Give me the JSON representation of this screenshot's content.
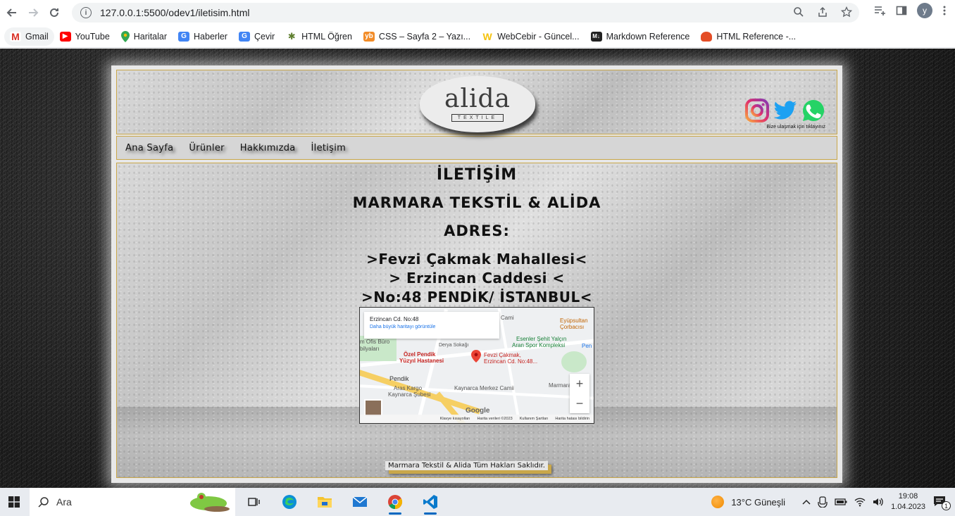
{
  "browser": {
    "url": "127.0.0.1:5500/odev1/iletisim.html",
    "avatar_letter": "y"
  },
  "bookmarks": [
    {
      "label": "Gmail",
      "icon": "gmail-icon",
      "color": "#d93025"
    },
    {
      "label": "YouTube",
      "icon": "youtube-icon",
      "color": "#ff0000"
    },
    {
      "label": "Haritalar",
      "icon": "maps-icon",
      "color": "#34a853"
    },
    {
      "label": "Haberler",
      "icon": "news-icon",
      "color": "#4285f4"
    },
    {
      "label": "Çevir",
      "icon": "translate-icon",
      "color": "#4285f4"
    },
    {
      "label": "HTML Öğren",
      "icon": "bug-icon",
      "color": "#5f7f2f"
    },
    {
      "label": "CSS – Sayfa 2 – Yazı...",
      "icon": "yb-icon",
      "color": "#f28c28"
    },
    {
      "label": "WebCebir - Güncel...",
      "icon": "w-icon",
      "color": "#f4c20d"
    },
    {
      "label": "Markdown Reference",
      "icon": "md-icon",
      "color": "#222222"
    },
    {
      "label": "HTML Reference -...",
      "icon": "html-ref-icon",
      "color": "#e44d26"
    }
  ],
  "site": {
    "logo_name": "alida",
    "logo_sub": "TEXTILE",
    "social_note": "Bize ulaşmak için tıklayınız",
    "nav": [
      "Ana Sayfa",
      "Ürünler",
      "Hakkımızda",
      "İletişim"
    ],
    "heading": "İLETİŞİM",
    "company": "MARMARA TEKSTİL & ALİDA",
    "address_label": "ADRES:",
    "address_lines": [
      ">Fevzi Çakmak Mahallesi<",
      "> Erzincan Caddesi <",
      ">No:48 PENDİK/ İSTANBUL<"
    ],
    "footer": "Marmara Tekstil & Alida Tüm Hakları Saklıdır."
  },
  "map": {
    "card_title": "Erzincan Cd. No:48",
    "card_link": "Daha büyük haritayı görüntüle",
    "pin_label_1": "Fevzi Çakmak,",
    "pin_label_2": "Erzincan Cd. No:48...",
    "places": {
      "cami": "Cami",
      "eyup_1": "Eyüpsultan",
      "eyup_2": "Çorbacısı",
      "esenler_1": "Esenler Şehit Yalçın",
      "esenler_2": "Aran Spor Kompleksi",
      "ofis_1": "m Ofis Büro",
      "ofis_2": "bilyaları",
      "derya": "Derya Sokağı",
      "hastane_1": "Özel Pendik",
      "hastane_2": "Yüzyıl Hastanesi",
      "pendik": "Pendik",
      "pen": "Pen",
      "aras_1": "Aras Kargo",
      "aras_2": "Kaynarca Şubesi",
      "merkez": "Kaynarca Merkez Camii",
      "marmara": "Marmara"
    },
    "google": "Google",
    "footer": [
      "Klavye kısayolları",
      "Harita verileri ©2023",
      "Kullanım Şartları",
      "Harita hatası bildirin"
    ]
  },
  "taskbar": {
    "search_placeholder": "Ara",
    "weather": "13°C  Güneşli",
    "time": "19:08",
    "date": "1.04.2023",
    "notification_count": "1"
  }
}
